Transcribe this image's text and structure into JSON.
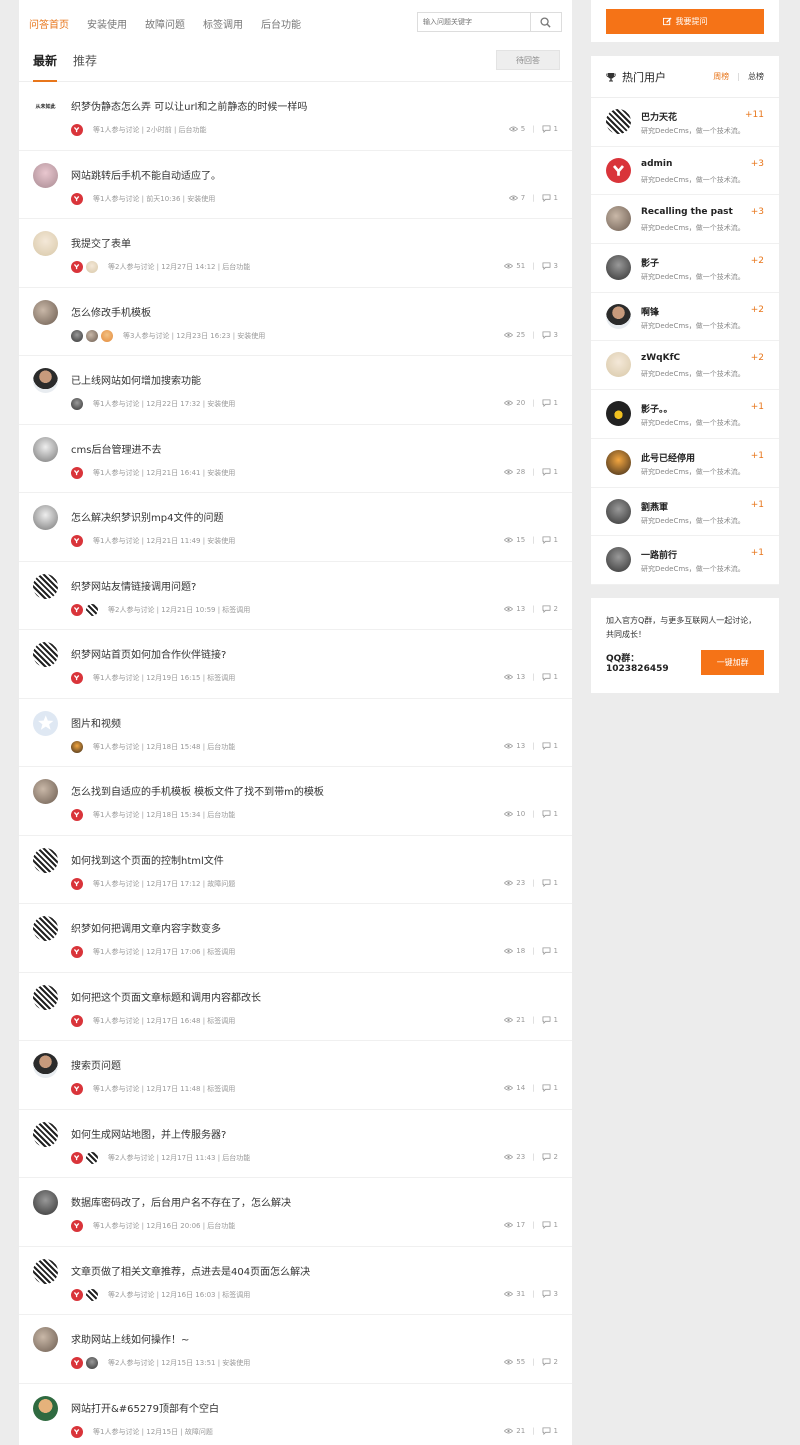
{
  "nav": {
    "items": [
      "问答首页",
      "安装使用",
      "故障问题",
      "标签调用",
      "后台功能"
    ],
    "active_index": 0,
    "search_placeholder": "输入问题关键字"
  },
  "tabs": {
    "items": [
      "最新",
      "推荐"
    ],
    "active_index": 0,
    "pending_label": "待回答"
  },
  "questions": [
    {
      "title": "织梦伪静态怎么弄 可以让url和之前静态的时候一样吗",
      "avatar": "text",
      "avatar_text": "从未如此",
      "participants": [
        "y"
      ],
      "meta": "等1人参与讨论 | 2小时前 | 后台功能",
      "views": "5",
      "answers": "1"
    },
    {
      "title": "网站跳转后手机不能自动适应了。",
      "avatar": "pink",
      "participants": [
        "y"
      ],
      "meta": "等1人参与讨论 | 前天10:36 | 安装使用",
      "views": "7",
      "answers": "1"
    },
    {
      "title": "我提交了表单",
      "avatar": "g2",
      "participants": [
        "y",
        "g2"
      ],
      "meta": "等2人参与讨论 | 12月27日 14:12 | 后台功能",
      "views": "51",
      "answers": "3"
    },
    {
      "title": "怎么修改手机模板",
      "avatar": "g1",
      "participants": [
        "g3",
        "g1",
        "fire"
      ],
      "meta": "等3人参与讨论 | 12月23日 16:23 | 安装使用",
      "views": "25",
      "answers": "3"
    },
    {
      "title": "已上线网站如何增加搜索功能",
      "avatar": "man",
      "participants": [
        "g3"
      ],
      "meta": "等1人参与讨论 | 12月22日 17:32 | 安装使用",
      "views": "20",
      "answers": "1"
    },
    {
      "title": "cms后台管理进不去",
      "avatar": "g4",
      "participants": [
        "y"
      ],
      "meta": "等1人参与讨论 | 12月21日 16:41 | 安装使用",
      "views": "28",
      "answers": "1"
    },
    {
      "title": "怎么解决织梦识别mp4文件的问题",
      "avatar": "g4",
      "participants": [
        "y"
      ],
      "meta": "等1人参与讨论 | 12月21日 11:49 | 安装使用",
      "views": "15",
      "answers": "1"
    },
    {
      "title": "织梦网站友情链接调用问题?",
      "avatar": "qr",
      "participants": [
        "y",
        "qr"
      ],
      "meta": "等2人参与讨论 | 12月21日 10:59 | 标签调用",
      "views": "13",
      "answers": "2"
    },
    {
      "title": "织梦网站首页如何加合作伙伴链接?",
      "avatar": "qr",
      "participants": [
        "y"
      ],
      "meta": "等1人参与讨论 | 12月19日 16:15 | 标签调用",
      "views": "13",
      "answers": "1"
    },
    {
      "title": "图片和视频",
      "avatar": "star",
      "participants": [
        "girl"
      ],
      "meta": "等1人参与讨论 | 12月18日 15:48 | 后台功能",
      "views": "13",
      "answers": "1"
    },
    {
      "title": "怎么找到自适应的手机模板 模板文件了找不到带m的模板",
      "avatar": "g1",
      "participants": [
        "y"
      ],
      "meta": "等1人参与讨论 | 12月18日 15:34 | 后台功能",
      "views": "10",
      "answers": "1"
    },
    {
      "title": "如何找到这个页面的控制html文件",
      "avatar": "qr",
      "participants": [
        "y"
      ],
      "meta": "等1人参与讨论 | 12月17日 17:12 | 故障问题",
      "views": "23",
      "answers": "1"
    },
    {
      "title": "织梦如何把调用文章内容字数变多",
      "avatar": "qr",
      "participants": [
        "y"
      ],
      "meta": "等1人参与讨论 | 12月17日 17:06 | 标签调用",
      "views": "18",
      "answers": "1"
    },
    {
      "title": "如何把这个页面文章标题和调用内容都改长",
      "avatar": "qr",
      "participants": [
        "y"
      ],
      "meta": "等1人参与讨论 | 12月17日 16:48 | 标签调用",
      "views": "21",
      "answers": "1"
    },
    {
      "title": "搜索页问题",
      "avatar": "man",
      "participants": [
        "y"
      ],
      "meta": "等1人参与讨论 | 12月17日 11:48 | 标签调用",
      "views": "14",
      "answers": "1"
    },
    {
      "title": "如何生成网站地图，并上传服务器?",
      "avatar": "qr",
      "participants": [
        "y",
        "qr"
      ],
      "meta": "等2人参与讨论 | 12月17日 11:43 | 后台功能",
      "views": "23",
      "answers": "2"
    },
    {
      "title": "数据库密码改了，后台用户名不存在了，怎么解决",
      "avatar": "g3",
      "participants": [
        "y"
      ],
      "meta": "等1人参与讨论 | 12月16日 20:06 | 后台功能",
      "views": "17",
      "answers": "1"
    },
    {
      "title": "文章页做了相关文章推荐，点进去是404页面怎么解决",
      "avatar": "qr",
      "participants": [
        "y",
        "qr"
      ],
      "meta": "等2人参与讨论 | 12月16日 16:03 | 标签调用",
      "views": "31",
      "answers": "3"
    },
    {
      "title": "求助网站上线如何操作！~",
      "avatar": "g1",
      "participants": [
        "y",
        "g3"
      ],
      "meta": "等2人参与讨论 | 12月15日 13:51 | 安装使用",
      "views": "55",
      "answers": "2"
    },
    {
      "title": "网站打开&#65279顶部有个空白",
      "avatar": "green",
      "participants": [
        "y"
      ],
      "meta": "等1人参与讨论 | 12月15日 | 故障问题",
      "views": "21",
      "answers": "1"
    }
  ],
  "sidebar": {
    "ask_label": "我要提问",
    "hot_title": "热门用户",
    "week_label": "周榜",
    "total_label": "总榜",
    "users": [
      {
        "name": "巴力天花",
        "desc": "研究DedeCms，做一个技术流。",
        "score": "+11",
        "avatar": "qr"
      },
      {
        "name": "admin",
        "desc": "研究DedeCms，做一个技术流。",
        "score": "+3",
        "avatar": "y"
      },
      {
        "name": "Recalling the past",
        "desc": "研究DedeCms，做一个技术流。",
        "score": "+3",
        "avatar": "g1"
      },
      {
        "name": "影子",
        "desc": "研究DedeCms，做一个技术流。",
        "score": "+2",
        "avatar": "g3"
      },
      {
        "name": "啊锋",
        "desc": "研究DedeCms，做一个技术流。",
        "score": "+2",
        "avatar": "man"
      },
      {
        "name": "zWqKfC",
        "desc": "研究DedeCms，做一个技术流。",
        "score": "+2",
        "avatar": "g2"
      },
      {
        "name": "影子。。",
        "desc": "研究DedeCms，做一个技术流。",
        "score": "+1",
        "avatar": "peng"
      },
      {
        "name": "此号已经停用",
        "desc": "研究DedeCms，做一个技术流。",
        "score": "+1",
        "avatar": "girl"
      },
      {
        "name": "劉燕軍",
        "desc": "研究DedeCms，做一个技术流。",
        "score": "+1",
        "avatar": "g3"
      },
      {
        "name": "一路前行",
        "desc": "研究DedeCms，做一个技术流。",
        "score": "+1",
        "avatar": "g3"
      }
    ],
    "join_text": "加入官方Q群，与更多互联网人一起讨论，共同成长！",
    "qq_label": "QQ群：1023826459",
    "join_button": "一键加群"
  },
  "colors": {
    "accent": "#e8761b",
    "button": "#f57317",
    "brand_red": "#d9343a"
  },
  "icons": {
    "search": "search-icon",
    "pencil": "pencil-icon",
    "trophy": "trophy-icon",
    "eye": "eye-icon",
    "comment": "comment-icon"
  }
}
